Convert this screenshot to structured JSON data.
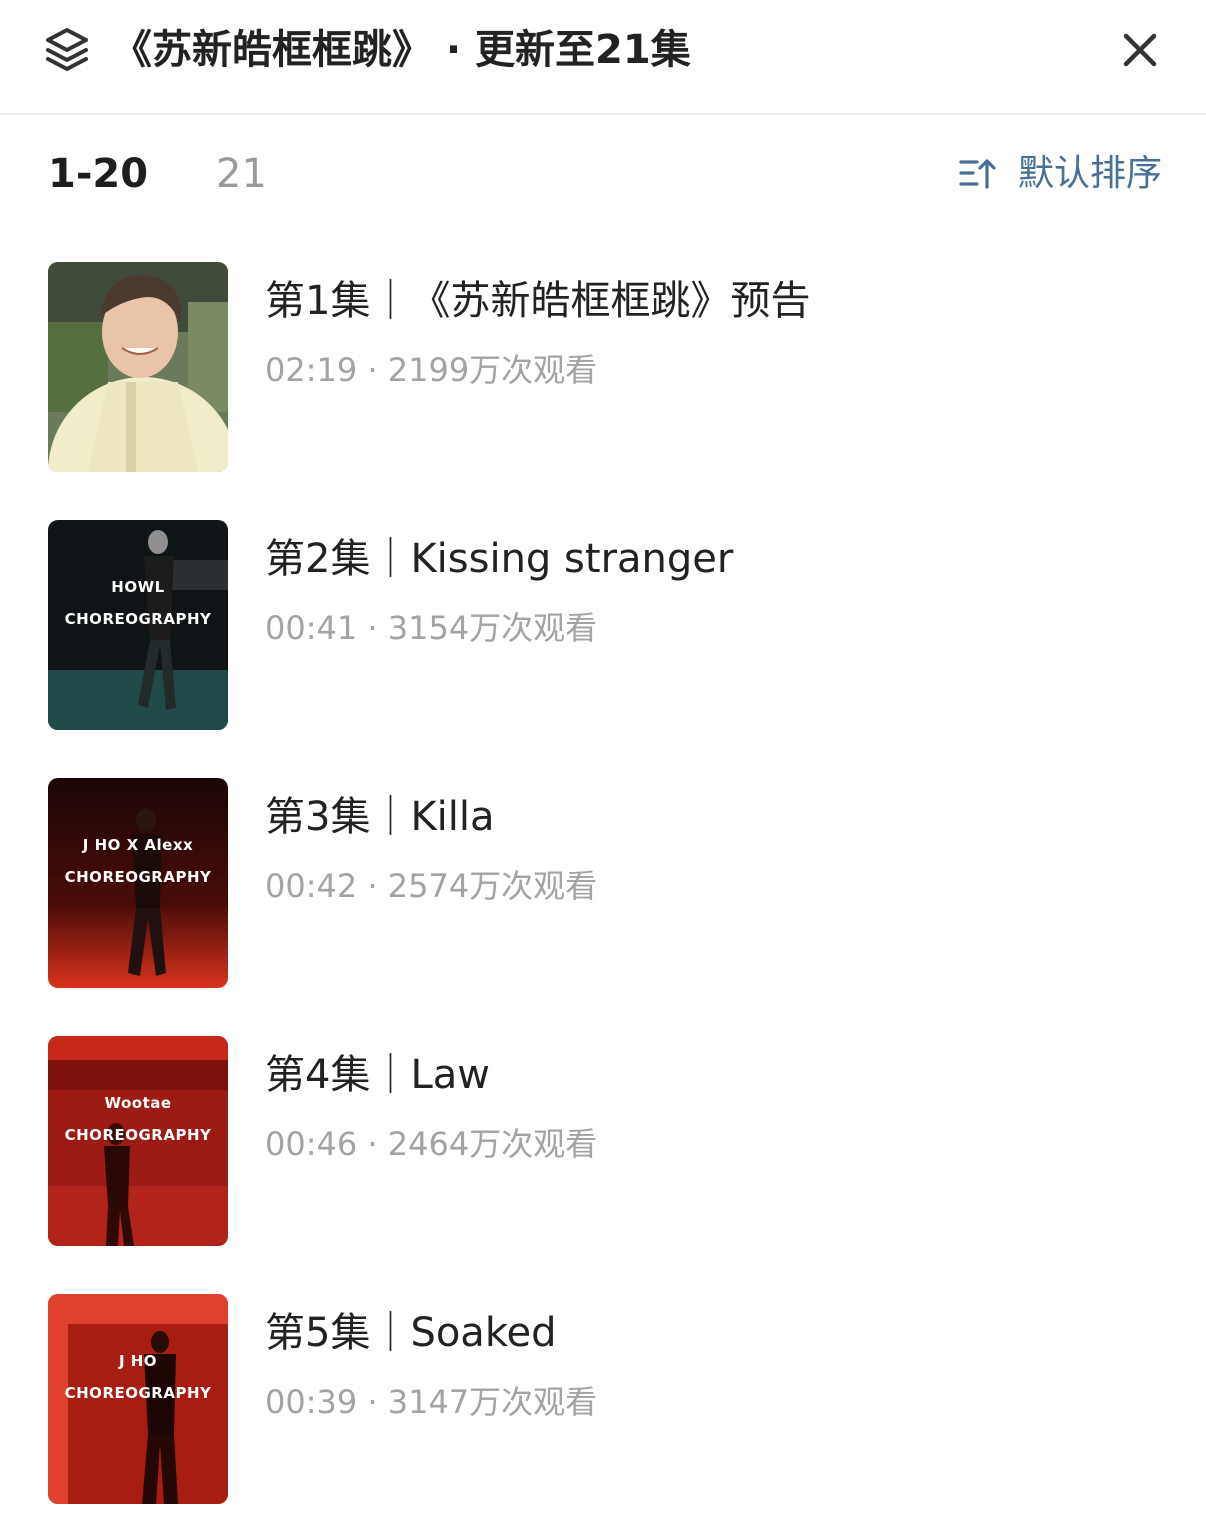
{
  "header": {
    "title": "《苏新皓框框跳》 · 更新至21集"
  },
  "tabs": [
    {
      "label": "1-20",
      "active": true
    },
    {
      "label": "21",
      "active": false
    }
  ],
  "sort": {
    "label": "默认排序"
  },
  "colors": {
    "accent": "#4a6f96",
    "meta": "#a3a3a3",
    "divider": "#efefef"
  },
  "episodes": [
    {
      "title": "第1集｜《苏新皓框框跳》预告",
      "duration": "02:19",
      "views": "2199万次观看",
      "meta": "02:19 · 2199万次观看",
      "thumb_text": [
        "",
        ""
      ]
    },
    {
      "title": "第2集｜Kissing stranger",
      "duration": "00:41",
      "views": "3154万次观看",
      "meta": "00:41 · 3154万次观看",
      "thumb_text": [
        "HOWL",
        "CHOREOGRAPHY"
      ]
    },
    {
      "title": "第3集｜Killa",
      "duration": "00:42",
      "views": "2574万次观看",
      "meta": "00:42 · 2574万次观看",
      "thumb_text": [
        "J HO X Alexx",
        "CHOREOGRAPHY"
      ]
    },
    {
      "title": "第4集｜Law",
      "duration": "00:46",
      "views": "2464万次观看",
      "meta": "00:46 · 2464万次观看",
      "thumb_text": [
        "Wootae",
        "CHOREOGRAPHY"
      ]
    },
    {
      "title": "第5集｜Soaked",
      "duration": "00:39",
      "views": "3147万次观看",
      "meta": "00:39 · 3147万次观看",
      "thumb_text": [
        "J HO",
        "CHOREOGRAPHY"
      ]
    }
  ]
}
